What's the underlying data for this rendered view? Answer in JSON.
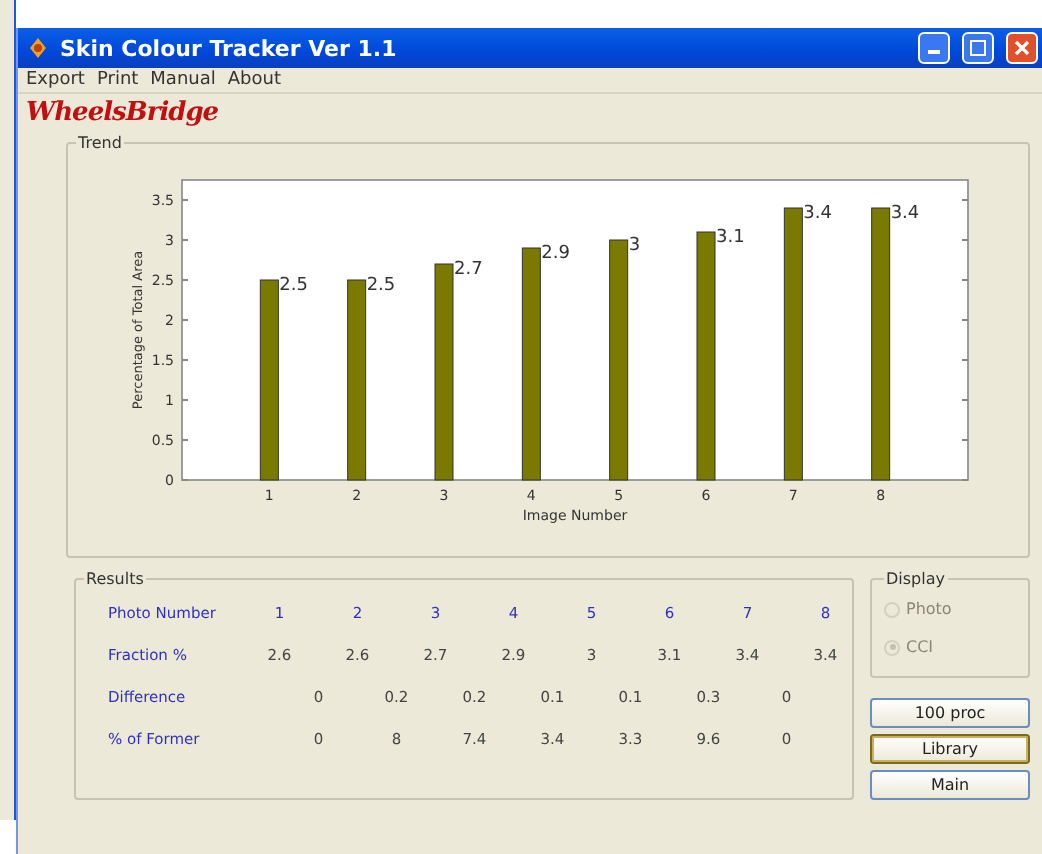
{
  "window": {
    "title": "Skin Colour Tracker Ver 1.1"
  },
  "menu": [
    "Export",
    "Print",
    "Manual",
    "About"
  ],
  "logo": {
    "text": "WheelsBridge"
  },
  "trend": {
    "title": "Trend",
    "chart_data": {
      "type": "bar",
      "xlabel": "Image Number",
      "ylabel": "Percentage of Total Area",
      "categories": [
        "1",
        "2",
        "3",
        "4",
        "5",
        "6",
        "7",
        "8"
      ],
      "series": [
        {
          "color": "#7a7a00",
          "values": [
            2.5,
            2.5,
            2.7,
            2.9,
            3,
            3.1,
            3.4,
            3.4
          ]
        }
      ],
      "ylim": [
        0,
        3.75
      ],
      "yticks": [
        0,
        0.5,
        1,
        1.5,
        2,
        2.5,
        3,
        3.5
      ],
      "value_labels": [
        "2.5",
        "2.5",
        "2.7",
        "2.9",
        "3",
        "3.1",
        "3.4",
        "3.4"
      ]
    }
  },
  "results": {
    "title": "Results",
    "rows": [
      {
        "kind": "header",
        "label": "Photo Number",
        "values": [
          "1",
          "2",
          "3",
          "4",
          "5",
          "6",
          "7",
          "8"
        ]
      },
      {
        "kind": "value",
        "label": "Fraction %",
        "values": [
          "2.6",
          "2.6",
          "2.7",
          "2.9",
          "3",
          "3.1",
          "3.4",
          "3.4"
        ]
      },
      {
        "kind": "between",
        "label": "Difference",
        "values": [
          "0",
          "0.2",
          "0.2",
          "0.1",
          "0.1",
          "0.3",
          "0"
        ]
      },
      {
        "kind": "between",
        "label": "% of Former",
        "values": [
          "0",
          "8",
          "7.4",
          "3.4",
          "3.3",
          "9.6",
          "0"
        ]
      }
    ]
  },
  "display": {
    "title": "Display",
    "disabled": true,
    "options": [
      {
        "label": "Photo",
        "selected": false
      },
      {
        "label": "CCI",
        "selected": true
      }
    ]
  },
  "buttons": [
    {
      "label": "100 proc",
      "focused": false
    },
    {
      "label": "Library",
      "focused": true
    },
    {
      "label": "Main",
      "focused": false
    }
  ]
}
